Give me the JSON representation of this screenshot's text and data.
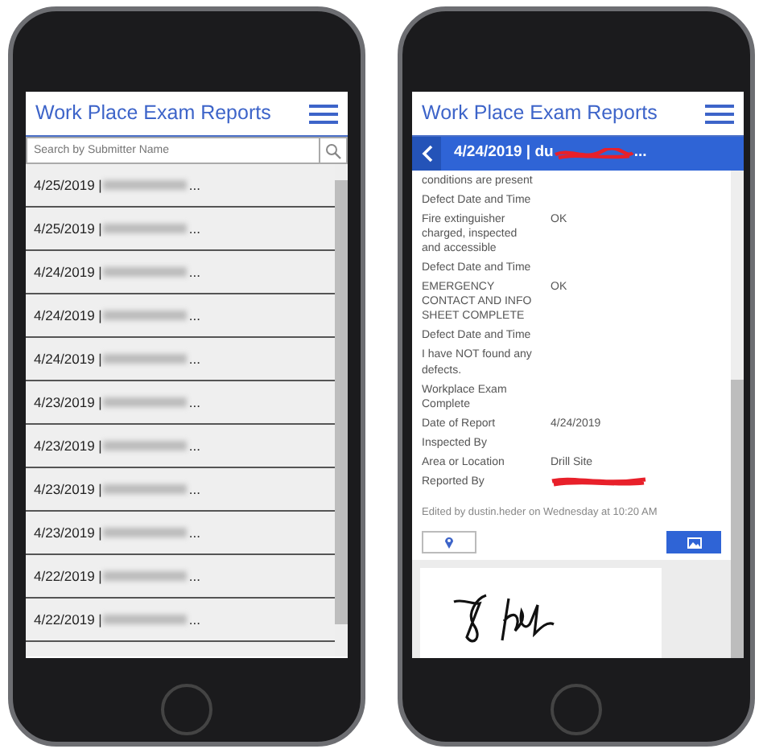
{
  "phones": [
    {
      "kind": "list",
      "title": "Work Place Exam Reports",
      "search": {
        "placeholder": "Search by Submitter Name"
      },
      "rows": [
        {
          "date": "4/25/2019 |",
          "suffix": "..."
        },
        {
          "date": "4/25/2019 |",
          "suffix": "..."
        },
        {
          "date": "4/24/2019 |",
          "suffix": "..."
        },
        {
          "date": "4/24/2019 |",
          "suffix": "..."
        },
        {
          "date": "4/24/2019 |",
          "suffix": "..."
        },
        {
          "date": "4/23/2019 |",
          "suffix": "..."
        },
        {
          "date": "4/23/2019 |",
          "suffix": "..."
        },
        {
          "date": "4/23/2019 |",
          "suffix": "..."
        },
        {
          "date": "4/23/2019 |",
          "suffix": "..."
        },
        {
          "date": "4/22/2019 |",
          "suffix": "..."
        },
        {
          "date": "4/22/2019 |",
          "suffix": "..."
        }
      ]
    },
    {
      "kind": "detail",
      "title": "Work Place Exam Reports",
      "header": {
        "prefix": "4/24/2019 | du",
        "suffix": "..."
      },
      "fields": [
        {
          "label": "conditions are present"
        },
        {
          "label": "Defect Date and Time"
        },
        {
          "label": "Fire extinguisher charged, inspected and accessible",
          "value": "OK"
        },
        {
          "label": "Defect Date and Time"
        },
        {
          "label": "EMERGENCY CONTACT AND INFO SHEET COMPLETE",
          "value": "OK"
        },
        {
          "label": "Defect Date and Time"
        },
        {
          "label": "I have NOT found any defects."
        },
        {
          "label": "Workplace Exam Complete"
        },
        {
          "label": "Date of Report",
          "value": "4/24/2019"
        },
        {
          "label": "Inspected By"
        },
        {
          "label": "Area or Location",
          "value": "Drill Site"
        },
        {
          "label": "Reported By",
          "redacted": true
        }
      ],
      "edited": "Edited by dustin.heder on Wednesday at 10:20 AM"
    }
  ]
}
